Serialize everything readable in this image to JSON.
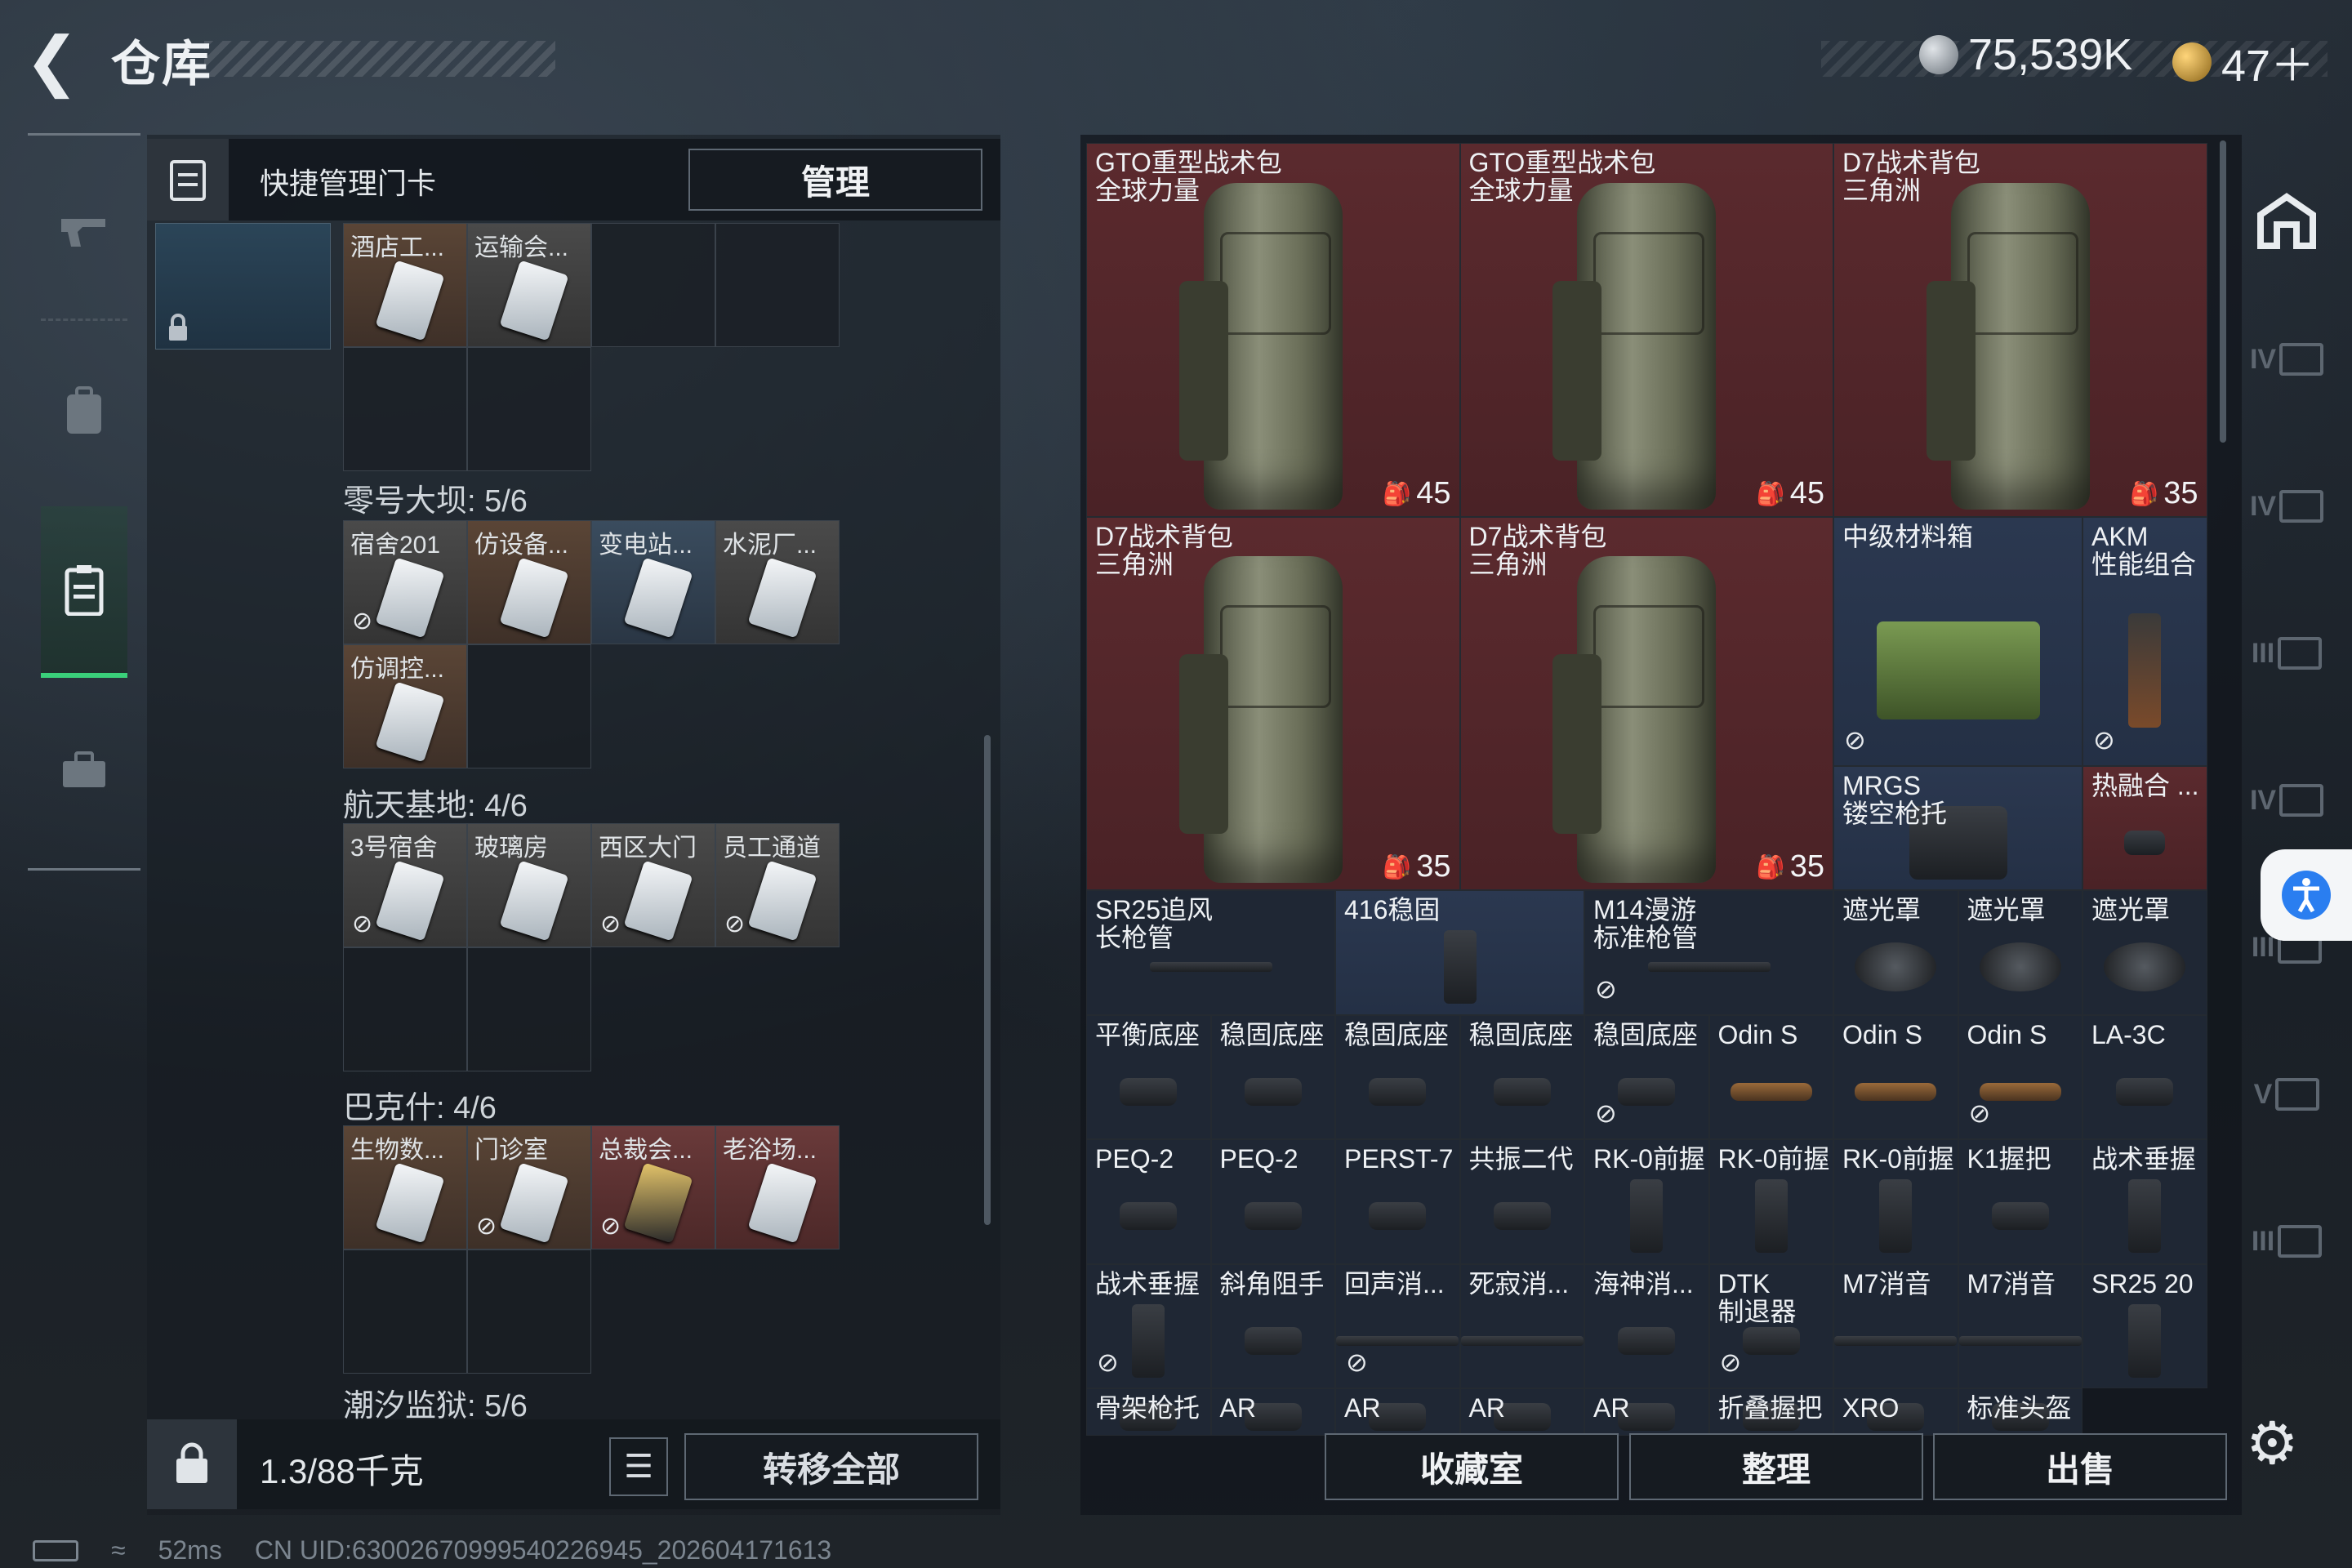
{
  "header": {
    "back_icon": "back-arrow-icon",
    "title": "仓库",
    "currency1": "75,539K",
    "currency2": "47＋"
  },
  "nav": {
    "items": [
      "weapon",
      "backpack",
      "keycard",
      "toolbox"
    ],
    "selected": "keycard"
  },
  "left_panel": {
    "head_label": "快捷管理门卡",
    "manage_label": "管理",
    "sections": [
      {
        "title": "",
        "cards": [
          {
            "label": "酒店工...",
            "tone": "brown",
            "ban": false
          },
          {
            "label": "运输会...",
            "tone": "gray",
            "ban": false
          }
        ]
      },
      {
        "title": "零号大坝: 5/6",
        "cards": [
          {
            "label": "宿舍201",
            "tone": "gray",
            "ban": true
          },
          {
            "label": "仿设备...",
            "tone": "brown",
            "ban": false
          },
          {
            "label": "变电站...",
            "tone": "blue",
            "ban": false
          },
          {
            "label": "水泥厂...",
            "tone": "gray",
            "ban": false
          },
          {
            "label": "仿调控...",
            "tone": "brown",
            "ban": false
          }
        ]
      },
      {
        "title": "航天基地: 4/6",
        "cards": [
          {
            "label": "3号宿舍",
            "tone": "gray",
            "ban": true
          },
          {
            "label": "玻璃房",
            "tone": "gray",
            "ban": false
          },
          {
            "label": "西区大门",
            "tone": "gray",
            "ban": true
          },
          {
            "label": "员工通道",
            "tone": "gray",
            "ban": true
          }
        ]
      },
      {
        "title": "巴克什: 4/6",
        "cards": [
          {
            "label": "生物数...",
            "tone": "brown",
            "ban": false
          },
          {
            "label": "门诊室",
            "tone": "brown",
            "ban": true
          },
          {
            "label": "总裁会...",
            "tone": "red",
            "ban": true
          },
          {
            "label": "老浴场...",
            "tone": "red",
            "ban": false
          }
        ]
      },
      {
        "title": "潮汐监狱: 5/6",
        "cards": []
      }
    ],
    "weight": "1.3/88千克",
    "transfer_label": "转移全部"
  },
  "status": {
    "ping": "52ms",
    "uid": "CN UID:630026709995402269​45_202604171613"
  },
  "items": [
    {
      "name": "GTO重型战术包\n全球力量",
      "tone": "red",
      "kind": "bag",
      "count": "45",
      "ban": false
    },
    {
      "name": "GTO重型战术包\n全球力量",
      "tone": "red",
      "kind": "bag",
      "count": "45",
      "ban": false
    },
    {
      "name": "D7战术背包\n三角洲",
      "tone": "red",
      "kind": "bag",
      "count": "35",
      "ban": false
    },
    {
      "name": "D7战术背包\n三角洲",
      "tone": "red",
      "kind": "bag",
      "count": "35",
      "ban": false
    },
    {
      "name": "D7战术背包\n三角洲",
      "tone": "red",
      "kind": "bag",
      "count": "35",
      "ban": false
    },
    {
      "name": "中级材料箱",
      "tone": "blue",
      "kind": "box",
      "count": "",
      "ban": true
    },
    {
      "name": "AKM\n性能组合",
      "tone": "blue",
      "kind": "gun",
      "count": "",
      "ban": true
    },
    {
      "name": "MRGS\n镂空枪托",
      "tone": "blue",
      "kind": "stock",
      "count": "",
      "ban": false
    },
    {
      "name": "热融合 ...",
      "tone": "red",
      "kind": "sight",
      "count": "",
      "ban": false
    },
    {
      "name": "SR25追风\n长枪管",
      "tone": "dark",
      "kind": "long",
      "count": "",
      "ban": false
    },
    {
      "name": "416稳固",
      "tone": "blue",
      "kind": "grip",
      "count": "",
      "ban": false
    },
    {
      "name": "M14漫游\n标准枪管",
      "tone": "dark",
      "kind": "long",
      "count": "",
      "ban": true
    },
    {
      "name": "遮光罩",
      "tone": "dark",
      "kind": "tube",
      "count": "",
      "ban": false
    },
    {
      "name": "遮光罩",
      "tone": "dark",
      "kind": "tube",
      "count": "",
      "ban": false
    },
    {
      "name": "遮光罩",
      "tone": "dark",
      "kind": "tube",
      "count": "",
      "ban": false
    },
    {
      "name": "平衡底座",
      "tone": "dark",
      "kind": "part",
      "count": "",
      "ban": false
    },
    {
      "name": "稳固底座",
      "tone": "dark",
      "kind": "part",
      "count": "",
      "ban": false
    },
    {
      "name": "稳固底座",
      "tone": "dark",
      "kind": "part",
      "count": "",
      "ban": false
    },
    {
      "name": "稳固底座",
      "tone": "dark",
      "kind": "part",
      "count": "",
      "ban": false
    },
    {
      "name": "稳固底座",
      "tone": "dark",
      "kind": "part",
      "count": "",
      "ban": true
    },
    {
      "name": "Odin S",
      "tone": "dark",
      "kind": "scope",
      "count": "",
      "ban": false
    },
    {
      "name": "Odin S",
      "tone": "dark",
      "kind": "scope",
      "count": "",
      "ban": false
    },
    {
      "name": "Odin S",
      "tone": "dark",
      "kind": "scope",
      "count": "",
      "ban": true
    },
    {
      "name": "LA-3C",
      "tone": "dark",
      "kind": "part",
      "count": "",
      "ban": false
    },
    {
      "name": "PEQ-2",
      "tone": "dark",
      "kind": "part",
      "count": "",
      "ban": false
    },
    {
      "name": "PEQ-2",
      "tone": "dark",
      "kind": "part",
      "count": "",
      "ban": false
    },
    {
      "name": "PERST-7",
      "tone": "dark",
      "kind": "part",
      "count": "",
      "ban": false
    },
    {
      "name": "共振二代",
      "tone": "dark",
      "kind": "part",
      "count": "",
      "ban": false
    },
    {
      "name": "RK-0前握",
      "tone": "dark",
      "kind": "grip",
      "count": "",
      "ban": false
    },
    {
      "name": "RK-0前握",
      "tone": "dark",
      "kind": "grip",
      "count": "",
      "ban": false
    },
    {
      "name": "RK-0前握",
      "tone": "dark",
      "kind": "grip",
      "count": "",
      "ban": false
    },
    {
      "name": "K1握把",
      "tone": "dark",
      "kind": "part",
      "count": "",
      "ban": false
    },
    {
      "name": "战术垂握",
      "tone": "dark",
      "kind": "grip",
      "count": "",
      "ban": false
    },
    {
      "name": "战术垂握",
      "tone": "dark",
      "kind": "grip",
      "count": "",
      "ban": true
    },
    {
      "name": "斜角阻手",
      "tone": "dark",
      "kind": "part",
      "count": "",
      "ban": false
    },
    {
      "name": "回声消...",
      "tone": "dark",
      "kind": "long",
      "count": "",
      "ban": true
    },
    {
      "name": "死寂消...",
      "tone": "dark",
      "kind": "long",
      "count": "",
      "ban": false
    },
    {
      "name": "海神消...",
      "tone": "dark",
      "kind": "part",
      "count": "",
      "ban": false
    },
    {
      "name": "DTK\n制退器",
      "tone": "dark",
      "kind": "part",
      "count": "",
      "ban": true
    },
    {
      "name": "M7消音",
      "tone": "dark",
      "kind": "long",
      "count": "",
      "ban": false
    },
    {
      "name": "M7消音",
      "tone": "dark",
      "kind": "long",
      "count": "",
      "ban": false
    },
    {
      "name": "SR25 20",
      "tone": "dark",
      "kind": "grip",
      "count": "",
      "ban": false
    },
    {
      "name": "骨架枪托",
      "tone": "dark",
      "kind": "part",
      "count": "",
      "ban": false
    },
    {
      "name": "AR",
      "tone": "dark",
      "kind": "part",
      "count": "",
      "ban": false
    },
    {
      "name": "AR",
      "tone": "dark",
      "kind": "part",
      "count": "",
      "ban": false
    },
    {
      "name": "AR",
      "tone": "dark",
      "kind": "part",
      "count": "",
      "ban": false
    },
    {
      "name": "AR",
      "tone": "dark",
      "kind": "part",
      "count": "",
      "ban": false
    },
    {
      "name": "折叠握把",
      "tone": "dark",
      "kind": "part",
      "count": "",
      "ban": false
    },
    {
      "name": "XRO",
      "tone": "dark",
      "kind": "part",
      "count": "",
      "ban": false
    },
    {
      "name": "标准头盔",
      "tone": "dark",
      "kind": "part",
      "count": "",
      "ban": false
    }
  ],
  "footer": {
    "collection_label": "收藏室",
    "sort_label": "整理",
    "sell_label": "出售"
  },
  "sidebar": {
    "tier_labels": [
      "IV",
      "IV",
      "III",
      "IV",
      "III",
      "V",
      "III"
    ]
  }
}
